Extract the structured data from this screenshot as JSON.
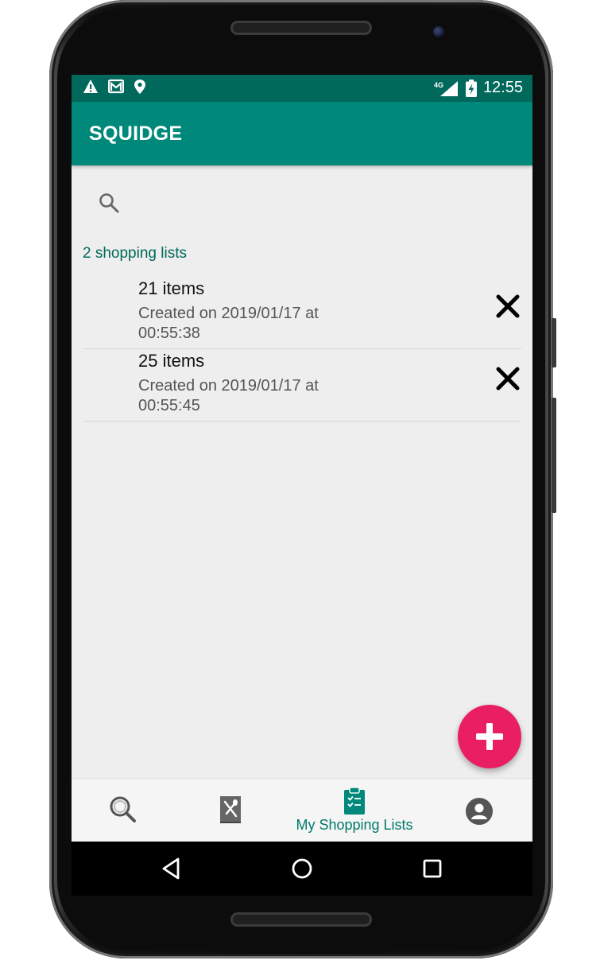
{
  "status_bar": {
    "icons": [
      "warning-icon",
      "gallery-icon",
      "location-icon"
    ],
    "network": "4G",
    "time": "12:55"
  },
  "app_bar": {
    "title": "SQUIDGE"
  },
  "search": {
    "icon": "search-icon"
  },
  "lists": {
    "count_label": "2 shopping lists",
    "items": [
      {
        "title": "21 items",
        "created": "Created on 2019/01/17 at 00:55:38"
      },
      {
        "title": "25 items",
        "created": "Created on 2019/01/17 at 00:55:45"
      }
    ]
  },
  "fab": {
    "icon": "plus-icon",
    "color": "#e91e63"
  },
  "bottom_nav": {
    "items": [
      {
        "icon": "search-icon",
        "label": ""
      },
      {
        "icon": "recipe-book-icon",
        "label": ""
      },
      {
        "icon": "clipboard-list-icon",
        "label": "My Shopping Lists",
        "active": true
      },
      {
        "icon": "account-icon",
        "label": ""
      }
    ]
  },
  "theme": {
    "primary": "#00897b",
    "primary_dark": "#00695c",
    "accent": "#e91e63"
  }
}
